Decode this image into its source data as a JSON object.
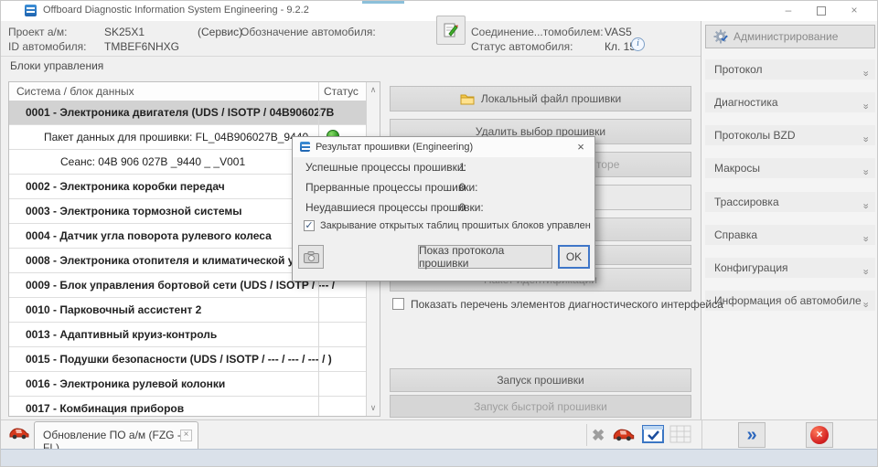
{
  "window": {
    "title": "Offboard Diagnostic Information System Engineering - 9.2.2",
    "minimize": "–",
    "close": "×"
  },
  "header": {
    "project_label": "Проект а/м:",
    "project_value": "SK25X1",
    "project_mode": "(Сервис)",
    "designation_label": "Обозначение автомобиля:",
    "vehicle_id_label": "ID автомобиля:",
    "vehicle_id_value": "TMBEF6NHXG",
    "connection_label": "Соединение...томобилем:",
    "connection_value": "VAS5",
    "status_label": "Статус автомобиля:",
    "status_value": "Кл. 15",
    "info_glyph": "i"
  },
  "sidebar": {
    "admin_label": "Администрирование",
    "chevron": "»",
    "items": [
      {
        "label": "Протокол"
      },
      {
        "label": "Диагностика"
      },
      {
        "label": "Протоколы BZD"
      },
      {
        "label": "Макросы"
      },
      {
        "label": "Трассировка"
      },
      {
        "label": "Справка"
      },
      {
        "label": "Конфигурация"
      },
      {
        "label": "Информация об автомобиле"
      }
    ]
  },
  "control_units": {
    "panel_title": "Блоки управления",
    "col_system": "Система / блок данных",
    "col_status": "Статус",
    "scroll_up": "∧",
    "scroll_down": "∨",
    "rows": [
      {
        "label": "0001 - Электроника двигателя  (UDS / ISOTP / 04B906027B"
      },
      {
        "label": "Пакет данных для прошивки: FL_04B906027B_9440_"
      },
      {
        "label": "Сеанс: 04B 906 027B _9440 _ _V001"
      },
      {
        "label": "0002 - Электроника коробки передач"
      },
      {
        "label": "0003 - Электроника тормозной системы"
      },
      {
        "label": "0004 - Датчик угла поворота рулевого колеса"
      },
      {
        "label": "0008 - Электроника отопителя и климатической уст"
      },
      {
        "label": "0009 - Блок управления бортовой сети  (UDS / ISOTP / --- /"
      },
      {
        "label": "0010 - Парковочный ассистент 2"
      },
      {
        "label": "0013 - Адаптивный круиз-контроль"
      },
      {
        "label": "0015 - Подушки безопасности  (UDS / ISOTP / --- / --- / --- /  )"
      },
      {
        "label": "0016 - Электроника рулевой колонки"
      },
      {
        "label": "0017 - Комбинация приборов"
      }
    ]
  },
  "actions": {
    "local_file": "Локальный файл прошивки",
    "clear_selection": "Удалить выбор прошивки",
    "repo_fragment": "торе",
    "ident_package": "Пакет идентификации",
    "show_elements_label": "Показать перечень элементов диагностического интерфейса",
    "start_flash": "Запуск прошивки",
    "start_fast_flash": "Запуск быстрой прошивки"
  },
  "dialog": {
    "title": "Результат прошивки (Engineering)",
    "close": "×",
    "stats": [
      {
        "label": "Успешные процессы прошивки:",
        "value": "1"
      },
      {
        "label": "Прерванные процессы прошивки:",
        "value": "0"
      },
      {
        "label": "Неудавшиеся процессы прошивки:",
        "value": "0"
      }
    ],
    "checkbox_label": "Закрывание открытых таблиц прошитых блоков управления",
    "checkbox_glyph": "✓",
    "show_log": "Показ протокола прошивки",
    "ok": "OK"
  },
  "bottom": {
    "tab_label": "Обновление ПО а/м (FZG - FL)",
    "tab_close": "×",
    "delete_glyph": "✖",
    "forward_glyph": "»",
    "close_glyph": "×"
  },
  "colors": {
    "accent_blue": "#2b66bd",
    "status_green": "#35a02a",
    "alert_red": "#d42323",
    "selection_gray": "#d2d2d2",
    "status_strip": "#dae1ea"
  }
}
